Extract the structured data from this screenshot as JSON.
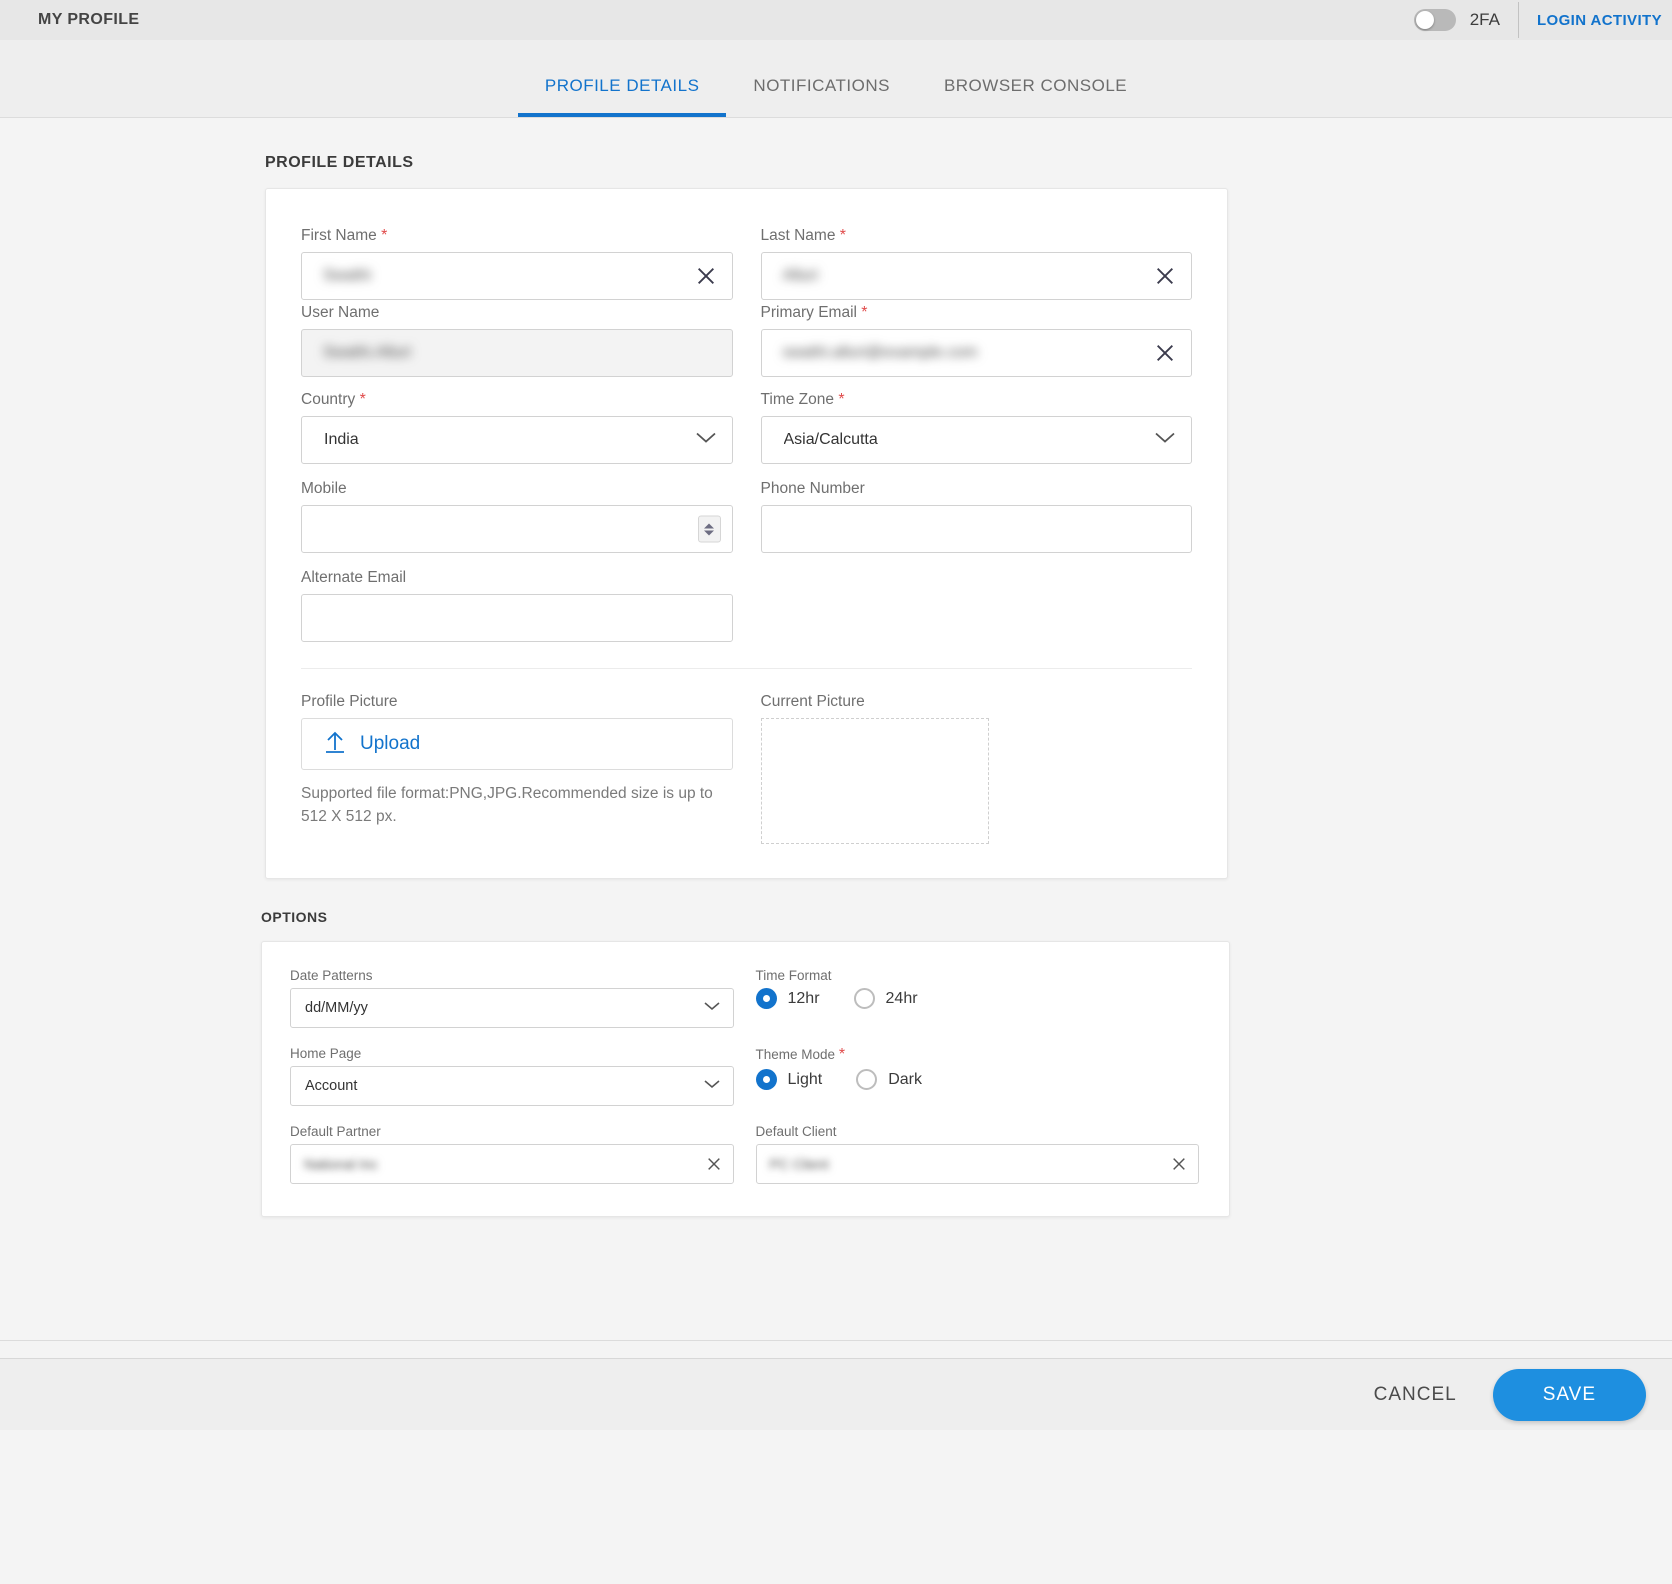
{
  "topbar": {
    "title": "MY PROFILE",
    "twofa_label": "2FA",
    "twofa_enabled": false,
    "login_activity_label": "LOGIN ACTIVITY"
  },
  "tabs": [
    {
      "label": "PROFILE DETAILS",
      "active": true
    },
    {
      "label": "NOTIFICATIONS",
      "active": false
    },
    {
      "label": "BROWSER CONSOLE",
      "active": false
    }
  ],
  "profile_section": {
    "heading": "PROFILE DETAILS",
    "fields": {
      "first_name": {
        "label": "First Name",
        "required": true,
        "value": "Swathi",
        "redacted": true
      },
      "last_name": {
        "label": "Last Name",
        "required": true,
        "value": "Alluri",
        "redacted": true
      },
      "user_name": {
        "label": "User Name",
        "required": false,
        "value": "Swathi.Alluri",
        "redacted": true,
        "disabled": true
      },
      "primary_email": {
        "label": "Primary Email",
        "required": true,
        "value": "swathi.alluri@example.com",
        "redacted": true
      },
      "country": {
        "label": "Country",
        "required": true,
        "value": "India"
      },
      "time_zone": {
        "label": "Time Zone",
        "required": true,
        "value": "Asia/Calcutta"
      },
      "mobile": {
        "label": "Mobile",
        "required": false,
        "value": ""
      },
      "phone_number": {
        "label": "Phone Number",
        "required": false,
        "value": ""
      },
      "alternate_email": {
        "label": "Alternate Email",
        "required": false,
        "value": ""
      },
      "profile_picture": {
        "label": "Profile Picture",
        "upload_label": "Upload",
        "helper": "Supported file format:PNG,JPG.Recommended size is up to 512 X 512 px."
      },
      "current_picture": {
        "label": "Current Picture"
      }
    }
  },
  "options_section": {
    "heading": "OPTIONS",
    "date_patterns": {
      "label": "Date Patterns",
      "value": "dd/MM/yy"
    },
    "home_page": {
      "label": "Home Page",
      "value": "Account"
    },
    "default_partner": {
      "label": "Default Partner",
      "value": "National Inc",
      "redacted": true
    },
    "default_client": {
      "label": "Default Client",
      "value": "PC Client",
      "redacted": true
    },
    "time_format": {
      "label": "Time Format",
      "required": false,
      "options": [
        {
          "label": "12hr",
          "selected": true
        },
        {
          "label": "24hr",
          "selected": false
        }
      ]
    },
    "theme_mode": {
      "label": "Theme Mode",
      "required": true,
      "options": [
        {
          "label": "Light",
          "selected": true
        },
        {
          "label": "Dark",
          "selected": false
        }
      ]
    }
  },
  "footer": {
    "cancel_label": "CANCEL",
    "save_label": "SAVE"
  },
  "colors": {
    "accent": "#1273cc",
    "save_button": "#1e8fe0",
    "required_star": "#e04a4a"
  }
}
